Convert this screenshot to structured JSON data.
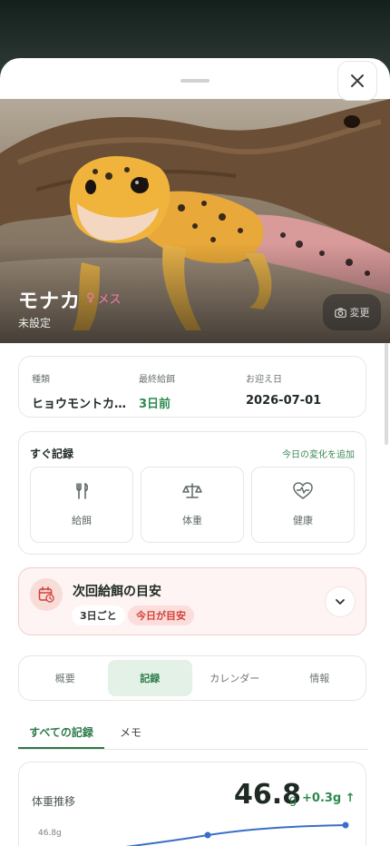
{
  "pet": {
    "name": "モナカ",
    "sex_symbol": "♀",
    "sex_label": "メス",
    "subtitle": "未設定",
    "change_photo_label": "変更"
  },
  "info": [
    {
      "label": "種類",
      "value": "ヒョウモントカゲモドキ"
    },
    {
      "label": "最終給餌",
      "value": "3日前"
    },
    {
      "label": "お迎え日",
      "value": "2026-07-01"
    }
  ],
  "quick": {
    "title": "すぐ記録",
    "link": "今日の変化を追加",
    "buttons": [
      {
        "label": "給餌",
        "icon": "fork-knife-icon"
      },
      {
        "label": "体重",
        "icon": "scale-icon"
      },
      {
        "label": "健康",
        "icon": "heart-pulse-icon"
      }
    ]
  },
  "feeding": {
    "title": "次回給餌の目安",
    "interval": "3日ごと",
    "status": "今日が目安"
  },
  "tabs": [
    "概要",
    "記録",
    "カレンダー",
    "情報"
  ],
  "active_tab": "記録",
  "subtabs": [
    "すべての記録",
    "メモ"
  ],
  "weight": {
    "title": "体重推移",
    "value": "46.8",
    "unit": "g",
    "delta": "+0.3g ↑",
    "axis_label": "46.8g"
  },
  "colors": {
    "accent_green": "#2c8a4e",
    "alert_red": "#d2403a",
    "sex_pink": "#f57cae",
    "chart_line": "#3a6fc8"
  }
}
